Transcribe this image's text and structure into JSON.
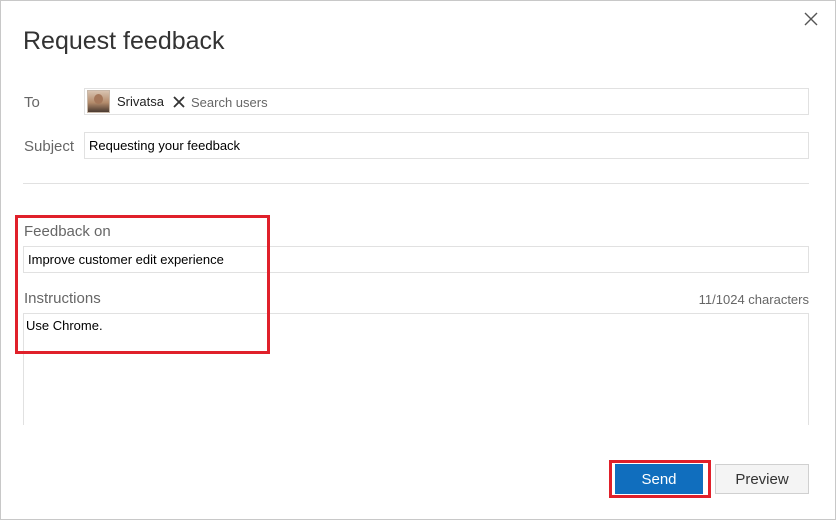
{
  "dialog": {
    "title": "Request feedback",
    "close_icon": "close-icon"
  },
  "to": {
    "label": "To",
    "recipients": [
      {
        "name": "Srivatsa",
        "avatar_icon": "user-avatar",
        "remove_icon": "close-icon"
      }
    ],
    "search_placeholder": "Search users"
  },
  "subject": {
    "label": "Subject",
    "value": "Requesting your feedback"
  },
  "feedback_on": {
    "label": "Feedback on",
    "value": "Improve customer edit experience"
  },
  "instructions": {
    "label": "Instructions",
    "char_count": "11/1024 characters",
    "value": "Use Chrome."
  },
  "buttons": {
    "send_label": "Send",
    "preview_label": "Preview"
  },
  "colors": {
    "primary": "#106ebe",
    "highlight": "#e0202a"
  }
}
